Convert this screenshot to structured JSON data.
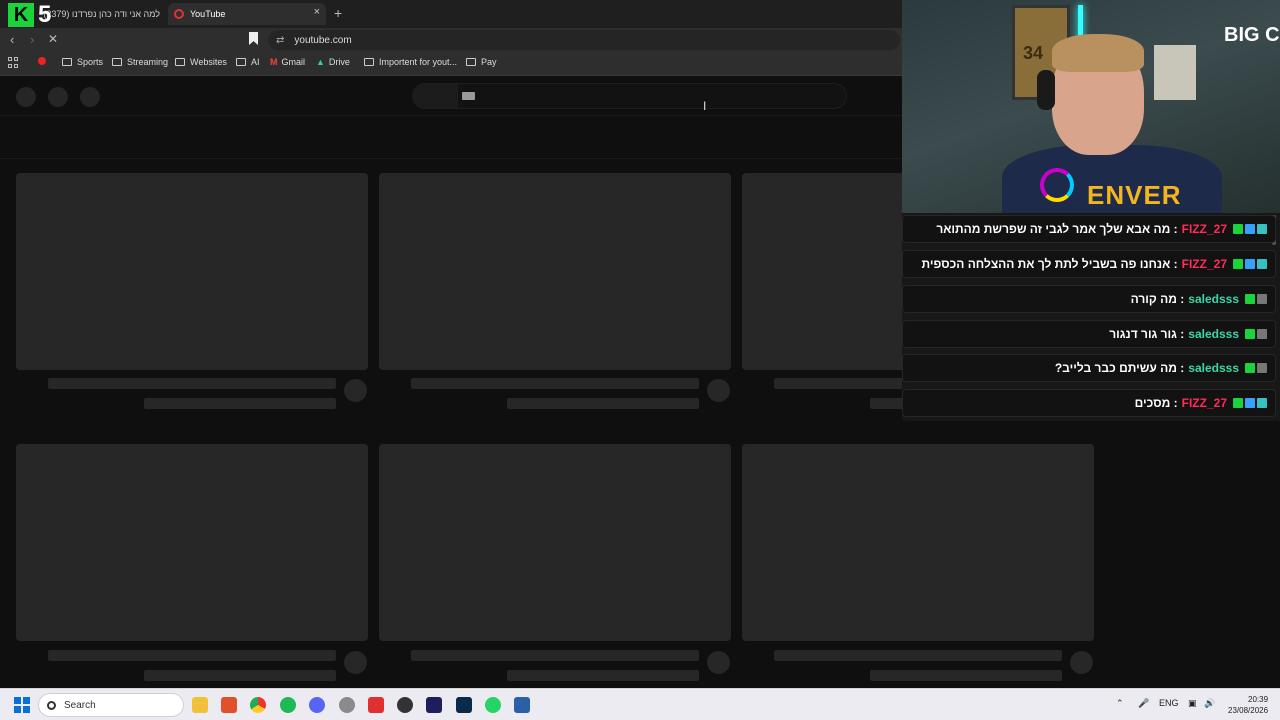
{
  "browser": {
    "tabs": [
      {
        "label": "למה אני ודה כהן נפרדנו (2379)"
      },
      {
        "label": "YouTube",
        "active": true
      }
    ],
    "new_tab": "+",
    "close": "×",
    "url": "youtube.com",
    "bookmarks": [
      {
        "label": "Sports"
      },
      {
        "label": "Streaming"
      },
      {
        "label": "Websites"
      },
      {
        "label": "AI"
      },
      {
        "label": "Gmail"
      },
      {
        "label": "Drive"
      },
      {
        "label": "Importent for yout..."
      },
      {
        "label": "Pay"
      }
    ]
  },
  "overlay": {
    "logo_k": "K",
    "logo_5": "5",
    "big_c": "BIG C",
    "jersey_number": "34",
    "jersey_text": "ENVER"
  },
  "chat": {
    "messages": [
      {
        "user": "FIZZ_27",
        "text": "מה אבא שלך אמר לגבי זה שפרשת מהתואר",
        "color": "#ff2d55"
      },
      {
        "user": "FIZZ_27",
        "text": "אנחנו פה בשביל לתת לך את ההצלחה הכספית",
        "color": "#ff2d55"
      },
      {
        "user": "saledsss",
        "text": "מה קורה",
        "color": "#3ad6a8"
      },
      {
        "user": "saledsss",
        "text": "גור גור דנגור",
        "color": "#3ad6a8"
      },
      {
        "user": "saledsss",
        "text": "מה עשיתם כבר בלייב?",
        "color": "#3ad6a8"
      },
      {
        "user": "FIZZ_27",
        "text": "מסכים",
        "color": "#ff2d55"
      }
    ]
  },
  "taskbar": {
    "search": "Search",
    "language": "ENG",
    "time": "20:39",
    "date": "23/08/2026"
  }
}
